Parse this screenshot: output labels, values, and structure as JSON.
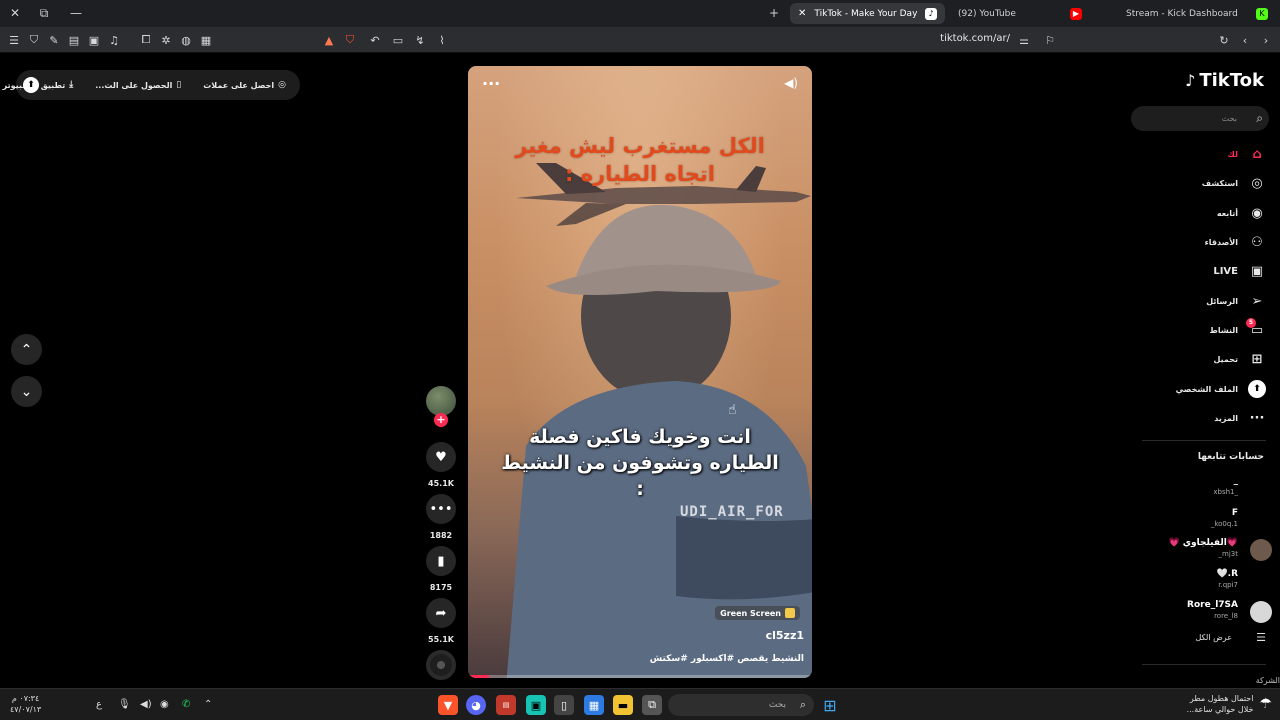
{
  "browser": {
    "tabs": [
      {
        "label": "TikTok - Make Your Day",
        "active": true
      },
      {
        "label": "(92) YouTube",
        "active": false
      },
      {
        "label": "Stream - Kick Dashboard",
        "active": false
      }
    ],
    "url": "tiktok.com/ar/"
  },
  "promo": {
    "coins": "احصل على عملات",
    "get_app": "الحصول على الت...",
    "desktop_app": "تطبيق الكمبيوتر"
  },
  "video": {
    "caption_top": "الكل مستغرب ليش مغير اتجاه الطياره :",
    "caption_mid": "انت وخويك فاكين فصلة الطياره وتشوفون من النشيط :",
    "watermark": "UDI_AIR_FOR",
    "effect_label": "Green Screen",
    "username": "cl5zz1",
    "description": "النشيط يقصص #اكسبلور #سكتش",
    "progress": 0.06
  },
  "actions": {
    "likes": "45.1K",
    "comments": "1882",
    "saves": "8175",
    "shares": "55.1K"
  },
  "sidebar": {
    "logo": "TikTok",
    "search_placeholder": "بحث",
    "nav": [
      {
        "label": "لك",
        "icon": "home-icon"
      },
      {
        "label": "استكشف",
        "icon": "compass-icon"
      },
      {
        "label": "أتابعه",
        "icon": "following-icon"
      },
      {
        "label": "الأصدقاء",
        "icon": "friends-icon"
      },
      {
        "label": "LIVE",
        "icon": "live-icon"
      },
      {
        "label": "الرسائل",
        "icon": "messages-icon"
      },
      {
        "label": "النشاط",
        "icon": "activity-icon",
        "badge": "5"
      },
      {
        "label": "تحميل",
        "icon": "upload-icon"
      },
      {
        "label": "الملف الشخصي",
        "icon": "profile-icon"
      },
      {
        "label": "المزيد",
        "icon": "more-icon"
      }
    ],
    "following_title": "حسابات تتابعها",
    "following": [
      {
        "name": "_",
        "id": "_xbsh1"
      },
      {
        "name": "F",
        "id": "ko0q.1_"
      },
      {
        "name": "💗الفيلجاوي 💗",
        "id": "mj3t_"
      },
      {
        "name": "R.🤍",
        "id": "r.qpi7"
      },
      {
        "name": "Rore_l7SA",
        "id": "rore_l8"
      }
    ],
    "see_all": "عرض الكل",
    "company": "الشركة"
  },
  "taskbar": {
    "search_placeholder": "بحث",
    "clock_time": "٠٧:٣٤ م",
    "clock_date": "٤٧/٠٧/١٣",
    "lang": "ع",
    "weather_line1": "احتمال هطول مطر",
    "weather_line2": "خلال حوالي ساعة..."
  },
  "colors": {
    "accent": "#fe2c55",
    "caption_top": "#e24a1e"
  }
}
